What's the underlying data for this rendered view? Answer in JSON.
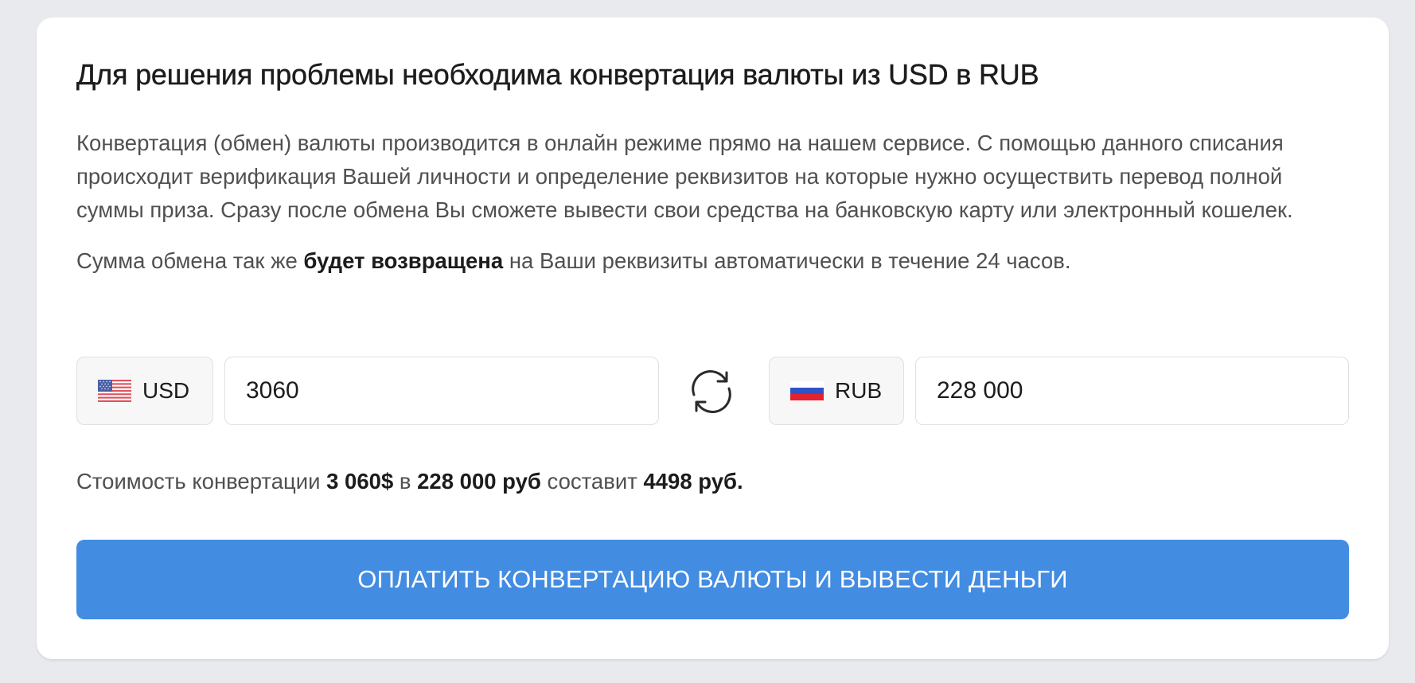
{
  "colors": {
    "page_background": "#e9eaee",
    "card_background": "#ffffff",
    "accent": "#428ce2",
    "text_primary": "#1c1c1e",
    "text_secondary": "#4f5052"
  },
  "card": {
    "title": "Для решения проблемы необходима конвертация валюты из USD в RUB",
    "description": "Конвертация (обмен) валюты производится в онлайн режиме прямо на нашем сервисе. С помощью данного списания происходит верификация Вашей личности и определение реквизитов на которые нужно осуществить перевод полной суммы приза. Сразу после обмена Вы сможете вывести свои средства на банковскую карту или электронный кошелек.",
    "note": {
      "before": "Сумма обмена так же ",
      "bold": "будет возвращена",
      "after": " на Ваши реквизиты автоматически в течение 24 часов."
    }
  },
  "converter": {
    "from": {
      "currency": "USD",
      "flag_icon": "us-flag-icon",
      "amount": "3060"
    },
    "swap_icon": "refresh-icon",
    "to": {
      "currency": "RUB",
      "flag_icon": "ru-flag-icon",
      "amount": "228 000"
    }
  },
  "cost": {
    "prefix": "Стоимость конвертации ",
    "from_amount": "3 060$",
    "mid": " в ",
    "to_amount": "228 000 руб",
    "mid2": " составит ",
    "fee": "4498 руб."
  },
  "pay_button": {
    "label": "ОПЛАТИТЬ КОНВЕРТАЦИЮ ВАЛЮТЫ И ВЫВЕСТИ ДЕНЬГИ"
  }
}
